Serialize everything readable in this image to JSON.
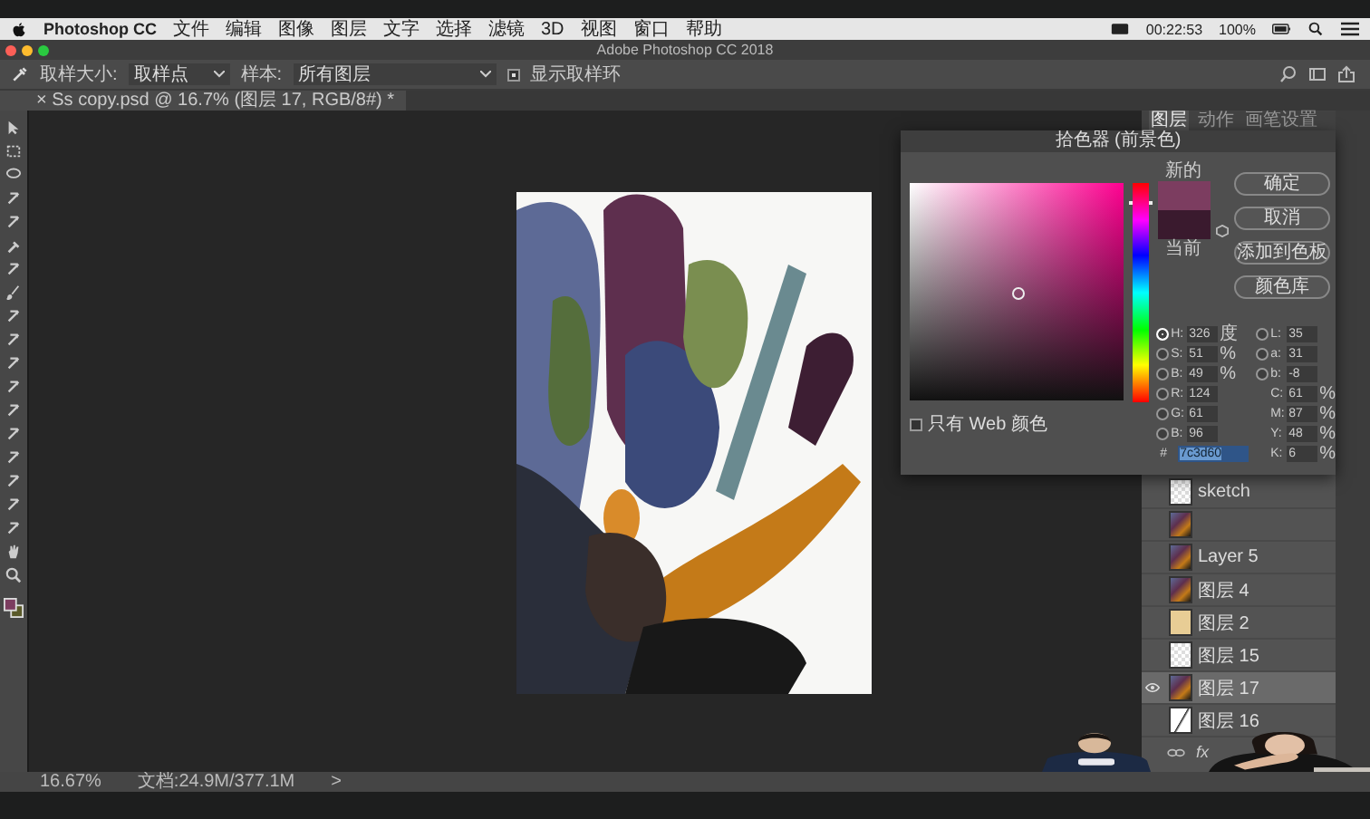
{
  "menu_bar": {
    "app": "Photoshop CC",
    "items": [
      "文件",
      "编辑",
      "图像",
      "图层",
      "文字",
      "选择",
      "滤镜",
      "3D",
      "视图",
      "窗口",
      "帮助"
    ],
    "clock": "00:22:53",
    "battery": "100%"
  },
  "window": {
    "title": "Adobe Photoshop CC 2018"
  },
  "options_bar": {
    "sample_size_label": "取样大小:",
    "sample_size": "取样点",
    "sample_label": "样本:",
    "sample": "所有图层",
    "show_ring": {
      "label": "显示取样环",
      "checked": true
    }
  },
  "document_tab": {
    "close": "×",
    "title": "Ss copy.psd @ 16.7% (图层 17, RGB/8#) *"
  },
  "color_picker": {
    "title": "拾色器 (前景色)",
    "new_label": "新的",
    "current_label": "当前",
    "buttons": [
      "确定",
      "取消",
      "添加到色板",
      "颜色库"
    ],
    "web_only": {
      "label": "只有 Web 颜色",
      "checked": false
    },
    "left_fields": [
      {
        "label": "H:",
        "value": "326",
        "unit": "度",
        "selected": true
      },
      {
        "label": "S:",
        "value": "51",
        "unit": "%",
        "selected": false
      },
      {
        "label": "B:",
        "value": "49",
        "unit": "%",
        "selected": false
      },
      {
        "label": "R:",
        "value": "124",
        "selected": false
      },
      {
        "label": "G:",
        "value": "61",
        "selected": false
      },
      {
        "label": "B:",
        "value": "96",
        "selected": false
      }
    ],
    "right_fields": [
      {
        "kind": "radio",
        "label": "L:",
        "value": "35",
        "selected": false
      },
      {
        "kind": "radio",
        "label": "a:",
        "value": "31",
        "selected": false
      },
      {
        "kind": "radio",
        "label": "b:",
        "value": "-8",
        "selected": false
      },
      {
        "kind": "plain",
        "label": "C:",
        "value": "61",
        "unit": "%"
      },
      {
        "kind": "plain",
        "label": "M:",
        "value": "87",
        "unit": "%"
      },
      {
        "kind": "plain",
        "label": "Y:",
        "value": "48",
        "unit": "%"
      },
      {
        "kind": "plain",
        "label": "K:",
        "value": "6",
        "unit": "%"
      }
    ],
    "hex_label": "#",
    "hex": "7c3d60"
  },
  "panel_tabs": [
    {
      "label": "图层",
      "selected": true
    },
    {
      "label": "动作",
      "selected": false
    },
    {
      "label": "画笔设置",
      "selected": false
    }
  ],
  "layers": [
    {
      "name": "sketch",
      "kind": "checker",
      "visible": false,
      "selected": false
    },
    {
      "kind": "art",
      "visible": false,
      "selected": false
    },
    {
      "name": "Layer 5",
      "kind": "art",
      "visible": false,
      "selected": false
    },
    {
      "name": "图层 4",
      "kind": "art",
      "visible": false,
      "selected": false
    },
    {
      "name": "图层 2",
      "kind": "beige",
      "visible": false,
      "selected": false
    },
    {
      "name": "图层 15",
      "kind": "checker",
      "visible": false,
      "selected": false
    },
    {
      "name": "图层 17",
      "kind": "art",
      "visible": true,
      "selected": true
    },
    {
      "name": "图层 16",
      "kind": "sketch",
      "visible": false,
      "selected": false
    }
  ],
  "layers_footer": {
    "fx": "fx"
  },
  "status_bar": {
    "zoom": "16.67%",
    "document": "文档:24.9M/377.1M",
    "arrow": ">"
  }
}
